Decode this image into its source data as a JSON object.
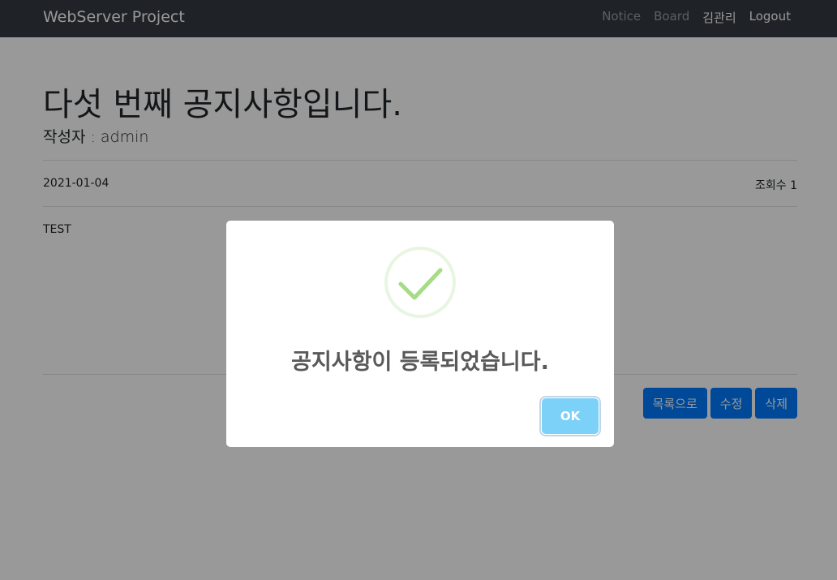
{
  "navbar": {
    "brand": "WebServer Project",
    "links": [
      "Notice",
      "Board",
      "김관리",
      "Logout"
    ]
  },
  "post": {
    "title": "다섯 번째 공지사항입니다.",
    "author": "작성자 : admin",
    "date": "2021-01-04",
    "views": "조회수 1",
    "body": "TEST"
  },
  "actions": {
    "list_label": "목록으로",
    "edit_label": "수정",
    "delete_label": "삭제"
  },
  "modal": {
    "icon": "check-icon",
    "message": "공지사항이 등록되었습니다.",
    "ok_label": "OK"
  },
  "colors": {
    "navbar_bg": "#343a40",
    "primary": "#007bff",
    "success_icon": "#a5dc86",
    "ok_button": "#7cd1f9"
  }
}
